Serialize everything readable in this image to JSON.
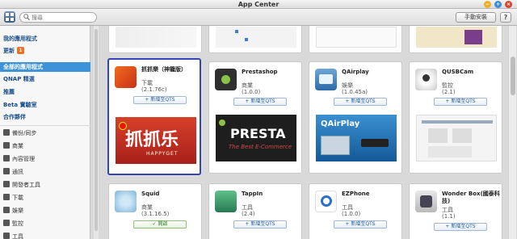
{
  "window": {
    "title": "App Center"
  },
  "toolbar": {
    "search_placeholder": "搜尋",
    "manual_install": "手動安裝",
    "help": "?"
  },
  "sidebar": {
    "top_items": [
      {
        "label": "我的應用程式"
      },
      {
        "label": "更新",
        "badge": "1"
      },
      {
        "label": "全部的應用程式"
      },
      {
        "label": "QNAP 精選"
      },
      {
        "label": "推薦"
      },
      {
        "label": "Beta 實驗室"
      },
      {
        "label": "合作夥伴"
      }
    ],
    "categories": [
      {
        "label": "備份/同步",
        "icon": "backup-icon"
      },
      {
        "label": "商業",
        "icon": "business-icon"
      },
      {
        "label": "內容管理",
        "icon": "content-icon"
      },
      {
        "label": "通訊",
        "icon": "communication-icon"
      },
      {
        "label": "開發者工具",
        "icon": "developer-tools-icon"
      },
      {
        "label": "下載",
        "icon": "download-icon"
      },
      {
        "label": "娛樂",
        "icon": "entertainment-icon"
      },
      {
        "label": "監控",
        "icon": "surveillance-icon"
      },
      {
        "label": "工具",
        "icon": "tools-icon"
      }
    ]
  },
  "apps": [
    {
      "name": "抓抓樂（神籠版）",
      "category": "下載",
      "version": "(2.1.76c)",
      "action": "+ 新增至QTS",
      "banner_text": "抓抓乐",
      "banner_sub": "HAPPYGET",
      "selected": true
    },
    {
      "name": "Prestashop",
      "category": "商業",
      "version": "(1.0.0)",
      "action": "+ 新增至QTS",
      "banner_text": "PRESTA",
      "banner_sub": "The Best E-Commerce"
    },
    {
      "name": "QAirplay",
      "category": "娛樂",
      "version": "(1.0.45a)",
      "action": "+ 新增至QTS",
      "banner_text": "QAirPlay"
    },
    {
      "name": "QUSBCam",
      "category": "監控",
      "version": "(2.1)",
      "action": "+ 新增至QTS"
    },
    {
      "name": "Squid",
      "category": "商業",
      "version": "(3.1.16.5)",
      "action": "✓ 開啟"
    },
    {
      "name": "TappIn",
      "category": "工具",
      "version": "(2.4)",
      "action": "+ 新增至QTS"
    },
    {
      "name": "EZPhone",
      "category": "工具",
      "version": "(1.0.0)",
      "action": "+ 新增至QTS"
    },
    {
      "name": "Wonder Box(國泰科技)",
      "category": "工具",
      "version": "(1.1)",
      "action": "+ 新增至QTS"
    }
  ]
}
